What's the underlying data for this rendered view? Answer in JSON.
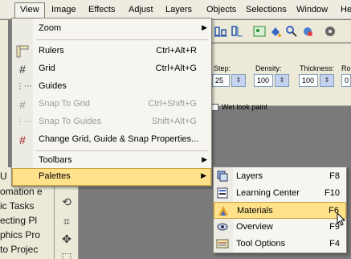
{
  "menubar": {
    "items": [
      {
        "label": "View",
        "active": true
      },
      {
        "label": "Image"
      },
      {
        "label": "Effects"
      },
      {
        "label": "Adjust"
      },
      {
        "label": "Layers"
      },
      {
        "label": "Objects"
      },
      {
        "label": "Selections"
      },
      {
        "label": "Window"
      },
      {
        "label": "He"
      }
    ]
  },
  "options": {
    "step_label": "Step:",
    "step_value": "25",
    "density_label": "Density:",
    "density_value": "100",
    "thickness_label": "Thickness:",
    "thickness_value": "100",
    "rot_label": "Ro",
    "rot_value": "0",
    "wet_label": "Wet look paint"
  },
  "left_panel": {
    "items": [
      "U",
      "omation e",
      "ic Tasks",
      "ecting Pl",
      "phics Pro",
      "to Projec"
    ]
  },
  "view_menu": {
    "items": [
      {
        "label": "Zoom",
        "shortcut": "",
        "submenu": true,
        "icon": "none"
      },
      {
        "label": "Rulers",
        "shortcut": "Ctrl+Alt+R",
        "icon": "ruler-icon"
      },
      {
        "label": "Grid",
        "shortcut": "Ctrl+Alt+G",
        "icon": "grid-icon"
      },
      {
        "label": "Guides",
        "shortcut": "",
        "icon": "guides-icon"
      },
      {
        "label": "Snap To Grid",
        "shortcut": "Ctrl+Shift+G",
        "disabled": true,
        "icon": "snap-grid-icon"
      },
      {
        "label": "Snap To Guides",
        "shortcut": "Shift+Alt+G",
        "disabled": true,
        "icon": "snap-guides-icon"
      },
      {
        "label": "Change Grid, Guide & Snap Properties...",
        "shortcut": "",
        "icon": "grid-properties-icon"
      },
      {
        "label": "Toolbars",
        "shortcut": "",
        "submenu": true,
        "icon": "none"
      },
      {
        "label": "Palettes",
        "shortcut": "",
        "submenu": true,
        "highlighted": true,
        "icon": "none"
      }
    ]
  },
  "palettes_submenu": {
    "items": [
      {
        "label": "Layers",
        "shortcut": "F8",
        "icon": "layers-icon"
      },
      {
        "label": "Learning Center",
        "shortcut": "F10",
        "icon": "learning-center-icon"
      },
      {
        "label": "Materials",
        "shortcut": "F6",
        "icon": "materials-icon",
        "highlighted": true
      },
      {
        "label": "Overview",
        "shortcut": "F9",
        "icon": "overview-icon"
      },
      {
        "label": "Tool Options",
        "shortcut": "F4",
        "icon": "tool-options-icon"
      }
    ]
  },
  "colors": {
    "highlight": "#ffe28a",
    "highlight_border": "#c9a23b",
    "menu_bg": "#f6f5f0",
    "disabled_text": "#9b9b9b"
  }
}
